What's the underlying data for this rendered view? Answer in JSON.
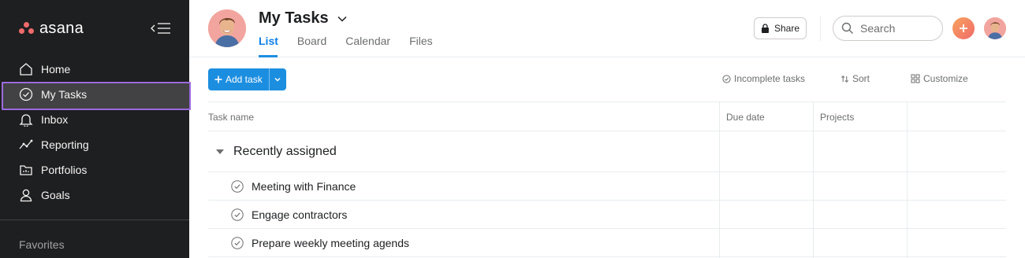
{
  "app": {
    "logo_text": "asana",
    "colors": {
      "sidebar_bg": "#1e1f21",
      "accent": "#1c8ee0",
      "active_outline": "#9c6ade",
      "brand": "#f06a6a"
    }
  },
  "sidebar": {
    "items": [
      {
        "label": "Home",
        "icon": "home-icon"
      },
      {
        "label": "My Tasks",
        "icon": "check-circle-icon",
        "active": true
      },
      {
        "label": "Inbox",
        "icon": "bell-icon"
      },
      {
        "label": "Reporting",
        "icon": "reporting-icon"
      },
      {
        "label": "Portfolios",
        "icon": "portfolio-icon"
      },
      {
        "label": "Goals",
        "icon": "person-icon"
      }
    ],
    "favorites_label": "Favorites"
  },
  "header": {
    "title": "My Tasks",
    "tabs": [
      {
        "label": "List",
        "active": true
      },
      {
        "label": "Board"
      },
      {
        "label": "Calendar"
      },
      {
        "label": "Files"
      }
    ],
    "share_label": "Share",
    "search_placeholder": "Search"
  },
  "toolbar": {
    "add_task_label": "Add task",
    "incomplete_label": "Incomplete tasks",
    "sort_label": "Sort",
    "customize_label": "Customize"
  },
  "table": {
    "columns": [
      "Task name",
      "Due date",
      "Projects"
    ],
    "section_title": "Recently assigned",
    "tasks": [
      {
        "name": "Meeting with Finance"
      },
      {
        "name": "Engage contractors"
      },
      {
        "name": "Prepare weekly meeting agends"
      }
    ]
  }
}
